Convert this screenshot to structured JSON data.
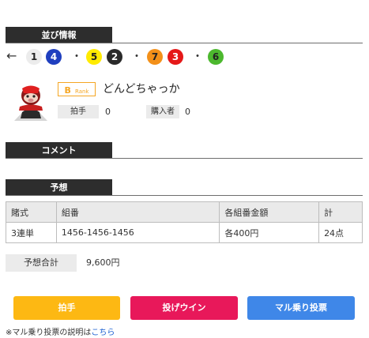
{
  "sections": {
    "lineup_title": "並び情報",
    "comment_title": "コメント",
    "prediction_title": "予想"
  },
  "lineup": {
    "arrow": "←",
    "groups": [
      [
        {
          "num": "1",
          "bg": "#ececec",
          "fg": "#222222"
        },
        {
          "num": "4",
          "bg": "#1f3fbf",
          "fg": "#ffffff"
        }
      ],
      [
        {
          "num": "5",
          "bg": "#ffeb00",
          "fg": "#222222"
        },
        {
          "num": "2",
          "bg": "#2a2a2a",
          "fg": "#ffffff"
        }
      ],
      [
        {
          "num": "7",
          "bg": "#f39019",
          "fg": "#222222"
        },
        {
          "num": "3",
          "bg": "#e51818",
          "fg": "#ffffff"
        }
      ],
      [
        {
          "num": "6",
          "bg": "#4cb82e",
          "fg": "#222222"
        }
      ]
    ],
    "separator": "・"
  },
  "profile": {
    "rank_letter": "B",
    "rank_word": "Rank",
    "username": "どんどちゃっか",
    "applause_label": "拍手",
    "applause_count": "0",
    "buyers_label": "購入者",
    "buyers_count": "0",
    "avatar_icon": "boar-mascot-icon"
  },
  "prediction_table": {
    "headers": [
      "賭式",
      "組番",
      "各組番金額",
      "計"
    ],
    "rows": [
      [
        "3連単",
        "1456-1456-1456",
        "各400円",
        "24点"
      ]
    ]
  },
  "prediction_total": {
    "label": "予想合計",
    "value": "9,600円"
  },
  "buttons": {
    "applause": "拍手",
    "bet_win": "投げウイン",
    "maru_bet": "マル乗り投票"
  },
  "colors": {
    "applause": "#fdb813",
    "bet_win": "#e8185a",
    "maru_bet": "#3f87e8",
    "rank": "#f5a623"
  },
  "note": {
    "text": "※マル乗り投票の説明は",
    "link": "こちら"
  }
}
